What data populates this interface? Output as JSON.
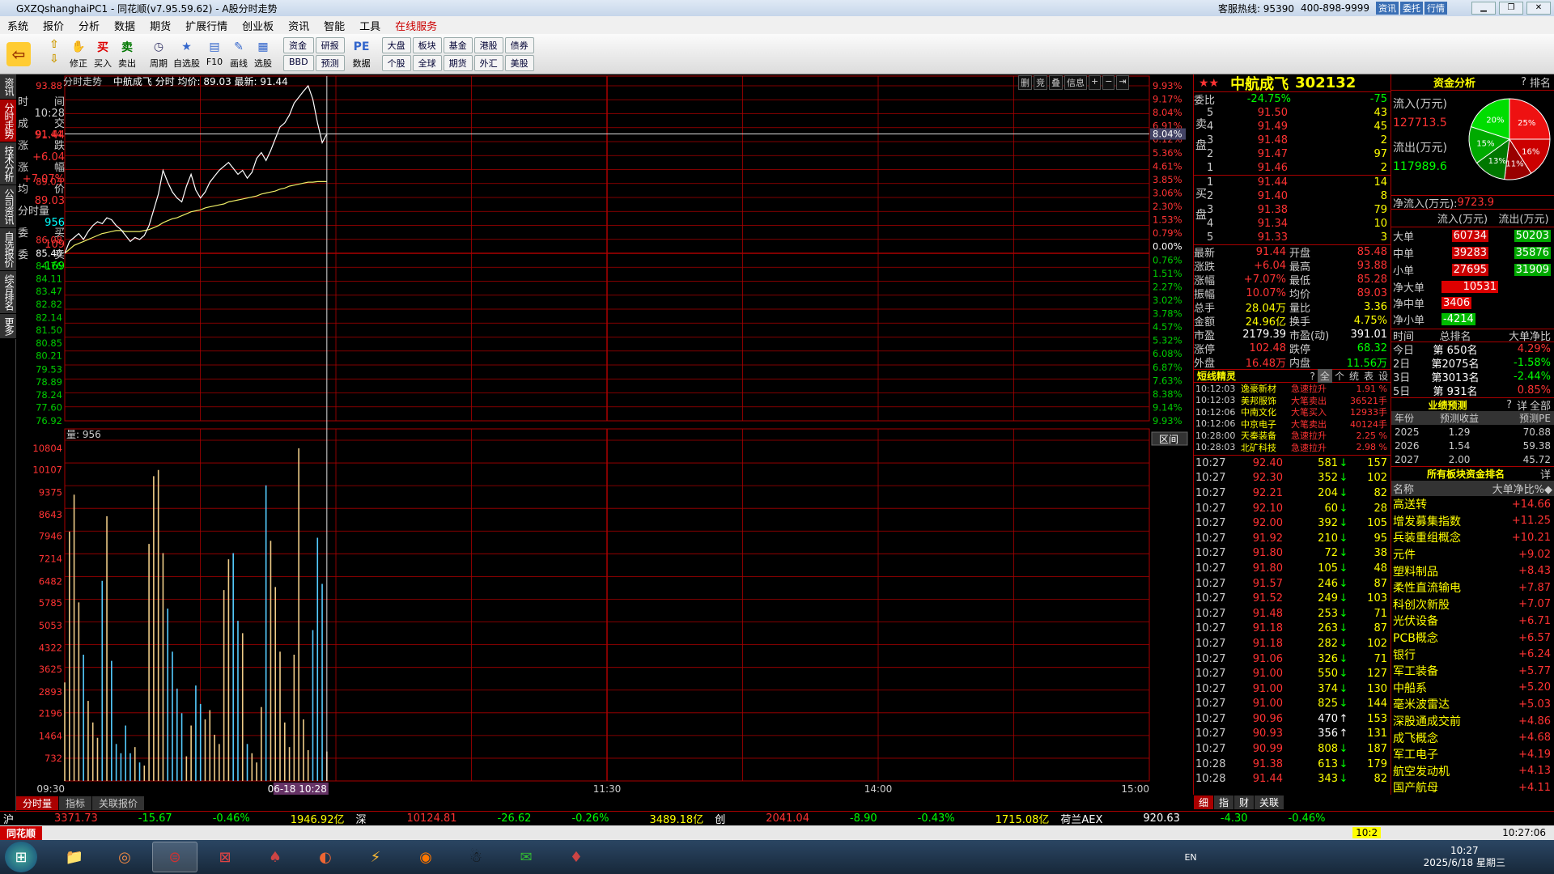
{
  "titlebar": {
    "title": "GXZQshanghaiPC1 - 同花顺(v7.95.59.62) - A股分时走势",
    "hotline": "客服热线: 95390",
    "phone": "400-898-9999",
    "b1": "资讯",
    "b2": "委托",
    "b3": "行情"
  },
  "menu": [
    "系统",
    "报价",
    "分析",
    "数据",
    "期货",
    "扩展行情",
    "创业板",
    "资讯",
    "智能",
    "工具",
    "在线服务"
  ],
  "toolbar": {
    "items": [
      "修正",
      "买入",
      "卖出",
      "周期",
      "自选股",
      "F10",
      "画线",
      "选股",
      "数据"
    ],
    "grp1": [
      "资金",
      "研报",
      "BBD",
      "预测"
    ],
    "grp2": [
      "大盘",
      "板块",
      "基金",
      "港股",
      "债券"
    ],
    "grp3": [
      "个股",
      "全球",
      "期货",
      "外汇",
      "美股"
    ]
  },
  "left_tabs": [
    "资讯",
    "分时走势",
    "技术分析",
    "公司资讯",
    "自选报价",
    "综合排名",
    "更多"
  ],
  "chart": {
    "header_title": "分时走势",
    "name": "中航成飞",
    "header_rest": "分时 均价: 89.03 最新: 91.44",
    "volume_label": "量: 956",
    "left_price_ticks": [
      "93.88",
      "91.44",
      "89.03",
      "86.08",
      "85.40",
      "84.76",
      "84.11",
      "83.47",
      "82.82",
      "82.14",
      "81.50",
      "80.85",
      "80.21",
      "79.53",
      "78.89",
      "78.24",
      "77.60",
      "76.92"
    ],
    "right_pct_ticks": [
      "9.93%",
      "9.17%",
      "8.04%",
      "6.91%",
      "6.12%",
      "5.36%",
      "4.61%",
      "3.85%",
      "3.06%",
      "2.30%",
      "1.53%",
      "0.79%",
      "0.00%",
      "0.76%",
      "1.51%",
      "2.27%",
      "3.02%",
      "3.78%",
      "4.57%",
      "5.32%",
      "6.08%",
      "6.87%",
      "7.63%",
      "8.38%",
      "9.14%",
      "9.93%"
    ],
    "vol_ticks": [
      "10804",
      "10107",
      "9375",
      "8643",
      "7946",
      "7214",
      "6482",
      "5785",
      "5053",
      "4322",
      "3625",
      "2893",
      "2196",
      "1464",
      "732"
    ],
    "times": [
      "09:30",
      "06-18 10:28",
      "11:30",
      "14:00",
      "15:00"
    ],
    "tools": [
      "删",
      "竞",
      "叠",
      "信息",
      "+",
      "−",
      "⇥"
    ],
    "region_btn": "区间"
  },
  "info_panel": [
    [
      "时",
      "间"
    ],
    [
      "10:28",
      ""
    ],
    [
      "成",
      "交"
    ],
    [
      "91.44",
      ""
    ],
    [
      "涨",
      "跌"
    ],
    [
      "+6.04",
      ""
    ],
    [
      "涨",
      "幅"
    ],
    [
      "+7.07%",
      ""
    ],
    [
      "均",
      "价"
    ],
    [
      "89.03",
      ""
    ],
    [
      "分时量",
      ""
    ],
    [
      "956",
      ""
    ],
    [
      "委",
      "买"
    ],
    [
      "109",
      ""
    ],
    [
      "委",
      "卖"
    ],
    [
      "-169",
      ""
    ]
  ],
  "bottom_tabs": [
    "分时量",
    "指标",
    "关联报价"
  ],
  "quote": {
    "stars": "★★",
    "name": "中航成飞",
    "code": "302132",
    "weibi_label": "委比",
    "weibi": "-24.75%",
    "weicha": "-75",
    "sell": [
      [
        "5",
        "91.50",
        "43"
      ],
      [
        "4",
        "91.49",
        "45"
      ],
      [
        "3",
        "91.48",
        "2"
      ],
      [
        "2",
        "91.47",
        "97"
      ],
      [
        "1",
        "91.46",
        "2"
      ]
    ],
    "buy": [
      [
        "1",
        "91.44",
        "14"
      ],
      [
        "2",
        "91.40",
        "8"
      ],
      [
        "3",
        "91.38",
        "79"
      ],
      [
        "4",
        "91.34",
        "10"
      ],
      [
        "5",
        "91.33",
        "3"
      ]
    ],
    "stats": [
      [
        "最新",
        "91.44",
        "开盘",
        "85.48"
      ],
      [
        "涨跌",
        "+6.04",
        "最高",
        "93.88"
      ],
      [
        "涨幅",
        "+7.07%",
        "最低",
        "85.28"
      ],
      [
        "振幅",
        "10.07%",
        "均价",
        "89.03"
      ],
      [
        "总手",
        "28.04万",
        "量比",
        "3.36"
      ],
      [
        "金额",
        "24.96亿",
        "换手",
        "4.75%"
      ],
      [
        "市盈",
        "2179.39",
        "市盈(动)",
        "391.01"
      ],
      [
        "涨停",
        "102.48",
        "跌停",
        "68.32"
      ],
      [
        "外盘",
        "16.48万",
        "内盘",
        "11.56万"
      ]
    ],
    "sprite_title": "短线精灵",
    "sprite_tabs": [
      "?",
      "全",
      "个",
      "统",
      "表",
      "设"
    ],
    "sprites": [
      [
        "10:12:03",
        "逸豪新材",
        "急速拉升",
        "1.91 %"
      ],
      [
        "10:12:03",
        "美邦服饰",
        "大笔卖出",
        "36521手"
      ],
      [
        "10:12:06",
        "中南文化",
        "大笔买入",
        "12933手"
      ],
      [
        "10:12:06",
        "中京电子",
        "大笔卖出",
        "40124手"
      ],
      [
        "10:28:00",
        "天秦装备",
        "急速拉升",
        "2.25 %"
      ],
      [
        "10:28:03",
        "北矿科技",
        "急速拉升",
        "2.98 %"
      ]
    ],
    "ticks": [
      [
        "10:27",
        "92.40",
        "581",
        "↓",
        "157"
      ],
      [
        "10:27",
        "92.30",
        "352",
        "↓",
        "102"
      ],
      [
        "10:27",
        "92.21",
        "204",
        "↓",
        "82"
      ],
      [
        "10:27",
        "92.10",
        "60",
        "↓",
        "28"
      ],
      [
        "10:27",
        "92.00",
        "392",
        "↓",
        "105"
      ],
      [
        "10:27",
        "91.92",
        "210",
        "↓",
        "95"
      ],
      [
        "10:27",
        "91.80",
        "72",
        "↓",
        "38"
      ],
      [
        "10:27",
        "91.80",
        "105",
        "↓",
        "48"
      ],
      [
        "10:27",
        "91.57",
        "246",
        "↓",
        "87"
      ],
      [
        "10:27",
        "91.52",
        "249",
        "↓",
        "103"
      ],
      [
        "10:27",
        "91.48",
        "253",
        "↓",
        "71"
      ],
      [
        "10:27",
        "91.18",
        "263",
        "↓",
        "87"
      ],
      [
        "10:27",
        "91.18",
        "282",
        "↓",
        "102"
      ],
      [
        "10:27",
        "91.06",
        "326",
        "↓",
        "71"
      ],
      [
        "10:27",
        "91.00",
        "550",
        "↓",
        "127"
      ],
      [
        "10:27",
        "91.00",
        "374",
        "↓",
        "130"
      ],
      [
        "10:27",
        "91.00",
        "825",
        "↓",
        "144"
      ],
      [
        "10:27",
        "90.96",
        "470",
        "↑",
        "153"
      ],
      [
        "10:27",
        "90.93",
        "356",
        "↑",
        "131"
      ],
      [
        "10:27",
        "90.99",
        "808",
        "↓",
        "187"
      ],
      [
        "10:28",
        "91.38",
        "613",
        "↓",
        "179"
      ],
      [
        "10:28",
        "91.44",
        "343",
        "↓",
        "82"
      ]
    ],
    "bottom_tabs": [
      "细",
      "指",
      "财",
      "关联"
    ]
  },
  "right": {
    "title": "资金分析",
    "btn": "排名",
    "inflow_label": "流入(万元)",
    "inflow": "127713.5",
    "outflow_label": "流出(万元)",
    "outflow": "117989.6",
    "net_label": "净流入(万元):",
    "net": "9723.9",
    "pie": [
      {
        "label": "25%",
        "color": "#e11"
      },
      {
        "label": "16%",
        "color": "#c00"
      },
      {
        "label": "11%",
        "color": "#900"
      },
      {
        "label": "13%",
        "color": "#070"
      },
      {
        "label": "15%",
        "color": "#0a0"
      },
      {
        "label": "20%",
        "color": "#0d0"
      }
    ],
    "flow_header": [
      "流入(万元)",
      "流出(万元)"
    ],
    "flow_rows": [
      [
        "大单",
        "60734",
        "50203"
      ],
      [
        "中单",
        "39283",
        "35876"
      ],
      [
        "小单",
        "27695",
        "31909"
      ]
    ],
    "net_rows": [
      [
        "净大单",
        "10531"
      ],
      [
        "净中单",
        "3406"
      ],
      [
        "净小单",
        "-4214"
      ]
    ],
    "rank_header": [
      "时间",
      "总排名",
      "大单净比"
    ],
    "rank_rows": [
      [
        "今日",
        "第 650名",
        "4.29%"
      ],
      [
        "2日",
        "第2075名",
        "-1.58%"
      ],
      [
        "3日",
        "第3013名",
        "-2.44%"
      ],
      [
        "5日",
        "第 931名",
        "0.85%"
      ]
    ],
    "forecast_title": "业绩预测",
    "forecast_header": [
      "年份",
      "预测收益",
      "预测PE"
    ],
    "forecast_rows": [
      [
        "2025",
        "1.29",
        "70.88"
      ],
      [
        "2026",
        "1.54",
        "59.38"
      ],
      [
        "2027",
        "2.00",
        "45.72"
      ]
    ],
    "sector_title": "所有板块资金排名",
    "sector_detail": "详",
    "sector_header": [
      "名称",
      "大单净比%◆"
    ],
    "sectors": [
      [
        "高送转",
        "+14.66"
      ],
      [
        "增发募集指数",
        "+11.25"
      ],
      [
        "兵装重组概念",
        "+10.21"
      ],
      [
        "元件",
        "+9.02"
      ],
      [
        "塑料制品",
        "+8.43"
      ],
      [
        "柔性直流输电",
        "+7.87"
      ],
      [
        "科创次新股",
        "+7.07"
      ],
      [
        "光伏设备",
        "+6.71"
      ],
      [
        "PCB概念",
        "+6.57"
      ],
      [
        "银行",
        "+6.24"
      ],
      [
        "军工装备",
        "+5.77"
      ],
      [
        "中船系",
        "+5.20"
      ],
      [
        "毫米波雷达",
        "+5.03"
      ],
      [
        "深股通成交前",
        "+4.86"
      ],
      [
        "成飞概念",
        "+4.68"
      ],
      [
        "军工电子",
        "+4.19"
      ],
      [
        "航空发动机",
        "+4.13"
      ],
      [
        "国产航母",
        "+4.11"
      ]
    ]
  },
  "status": [
    [
      "沪",
      "3371.73",
      "-15.67",
      "-0.46%",
      "1946.92亿"
    ],
    [
      "深",
      "10124.81",
      "-26.62",
      "-0.26%",
      "3489.18亿"
    ],
    [
      "创",
      "2041.04",
      "-8.90",
      "-0.43%",
      "1715.08亿"
    ],
    [
      "荷兰AEX",
      "920.63",
      "-4.30",
      "-0.46%",
      ""
    ]
  ],
  "bottombar": {
    "brand": "同花顺",
    "page": "10:2",
    "clock": "10:27:06"
  },
  "taskbar": {
    "apps": [
      "文件夹",
      "浏览器",
      "同花顺",
      "通达信",
      "扑克",
      "旋风",
      "闪电",
      "火狐",
      "QQ",
      "微信",
      "游戏"
    ],
    "time": "10:27",
    "date": "2025/6/18 星期三",
    "ime": "EN"
  },
  "series": {
    "price": [
      85.4,
      86.0,
      86.2,
      86.4,
      86.1,
      86.5,
      86.8,
      87.0,
      86.9,
      87.2,
      87.1,
      86.8,
      86.6,
      86.3,
      86.0,
      86.2,
      86.1,
      86.3,
      86.8,
      87.6,
      88.4,
      89.6,
      89.0,
      88.5,
      88.2,
      88.0,
      88.8,
      89.4,
      88.6,
      88.2,
      88.5,
      89.0,
      89.3,
      89.6,
      89.8,
      90.0,
      89.7,
      89.4,
      89.6,
      89.2,
      89.5,
      90.2,
      90.5,
      90.1,
      90.6,
      91.2,
      91.8,
      92.0,
      92.4,
      93.0,
      93.3,
      93.6,
      93.88,
      93.2,
      92.0,
      91.0,
      91.44
    ],
    "avg": [
      85.4,
      85.6,
      85.8,
      85.9,
      86.0,
      86.1,
      86.2,
      86.3,
      86.4,
      86.45,
      86.5,
      86.55,
      86.55,
      86.5,
      86.5,
      86.5,
      86.5,
      86.55,
      86.6,
      86.7,
      86.8,
      86.95,
      87.05,
      87.15,
      87.2,
      87.3,
      87.4,
      87.5,
      87.55,
      87.6,
      87.7,
      87.75,
      87.8,
      87.85,
      87.9,
      88.0,
      88.05,
      88.1,
      88.15,
      88.2,
      88.25,
      88.3,
      88.4,
      88.45,
      88.5,
      88.55,
      88.65,
      88.7,
      88.8,
      88.85,
      88.9,
      88.95,
      89.0,
      89.0,
      89.03,
      89.03,
      89.03
    ],
    "vol": [
      3200,
      8100,
      9300,
      5800,
      4100,
      2600,
      1900,
      1400,
      6500,
      8600,
      3900,
      1200,
      900,
      1800,
      900,
      1100,
      600,
      500,
      7700,
      9900,
      10100,
      7400,
      5600,
      4200,
      3000,
      2200,
      800,
      1800,
      3100,
      2500,
      2000,
      2300,
      1500,
      1200,
      6200,
      7200,
      7400,
      5200,
      4800,
      1200,
      900,
      600,
      2400,
      9600,
      7800,
      6300,
      4200,
      1900,
      1100,
      4100,
      10804,
      2000,
      1000,
      4900,
      7900,
      6400,
      956
    ]
  }
}
